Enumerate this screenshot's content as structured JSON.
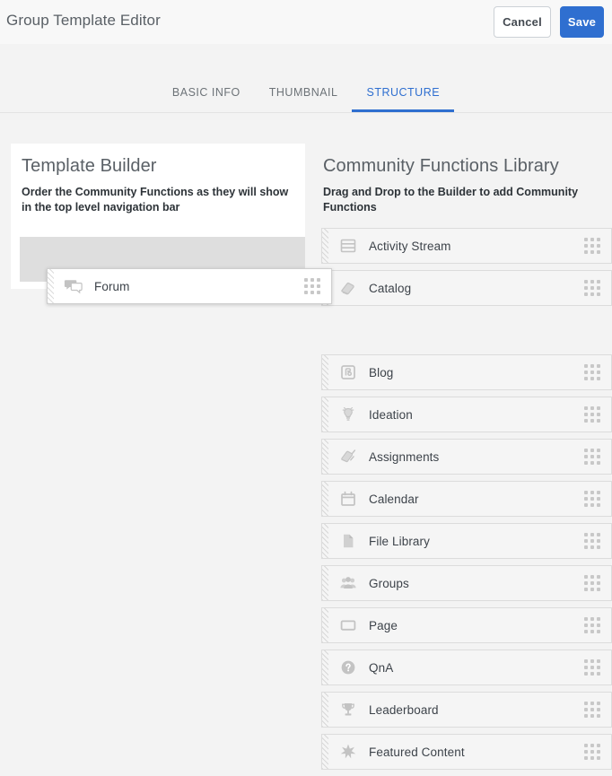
{
  "header": {
    "title": "Group Template Editor",
    "cancel_label": "Cancel",
    "save_label": "Save",
    "accent_color": "#2f6fd0"
  },
  "tabs": [
    {
      "label": "BASIC INFO",
      "active": false
    },
    {
      "label": "THUMBNAIL",
      "active": false
    },
    {
      "label": "STRUCTURE",
      "active": true
    }
  ],
  "builder": {
    "title": "Template Builder",
    "subtitle": "Order the Community Functions as they will show in the top level navigation bar",
    "placeholder_color": "#dedede"
  },
  "library": {
    "title": "Community Functions Library",
    "subtitle": "Drag and Drop to the Builder to add Community Functions",
    "items": [
      {
        "label": "Activity Stream",
        "icon": "activity-stream-icon"
      },
      {
        "label": "Catalog",
        "icon": "catalog-icon"
      },
      {
        "label": "Blog",
        "icon": "blog-icon"
      },
      {
        "label": "Ideation",
        "icon": "ideation-icon"
      },
      {
        "label": "Assignments",
        "icon": "assignments-icon"
      },
      {
        "label": "Calendar",
        "icon": "calendar-icon"
      },
      {
        "label": "File Library",
        "icon": "file-library-icon"
      },
      {
        "label": "Groups",
        "icon": "groups-icon"
      },
      {
        "label": "Page",
        "icon": "page-icon"
      },
      {
        "label": "QnA",
        "icon": "qna-icon"
      },
      {
        "label": "Leaderboard",
        "icon": "leaderboard-icon"
      },
      {
        "label": "Featured Content",
        "icon": "featured-content-icon"
      }
    ]
  },
  "drag": {
    "label": "Forum",
    "icon": "forum-icon"
  }
}
